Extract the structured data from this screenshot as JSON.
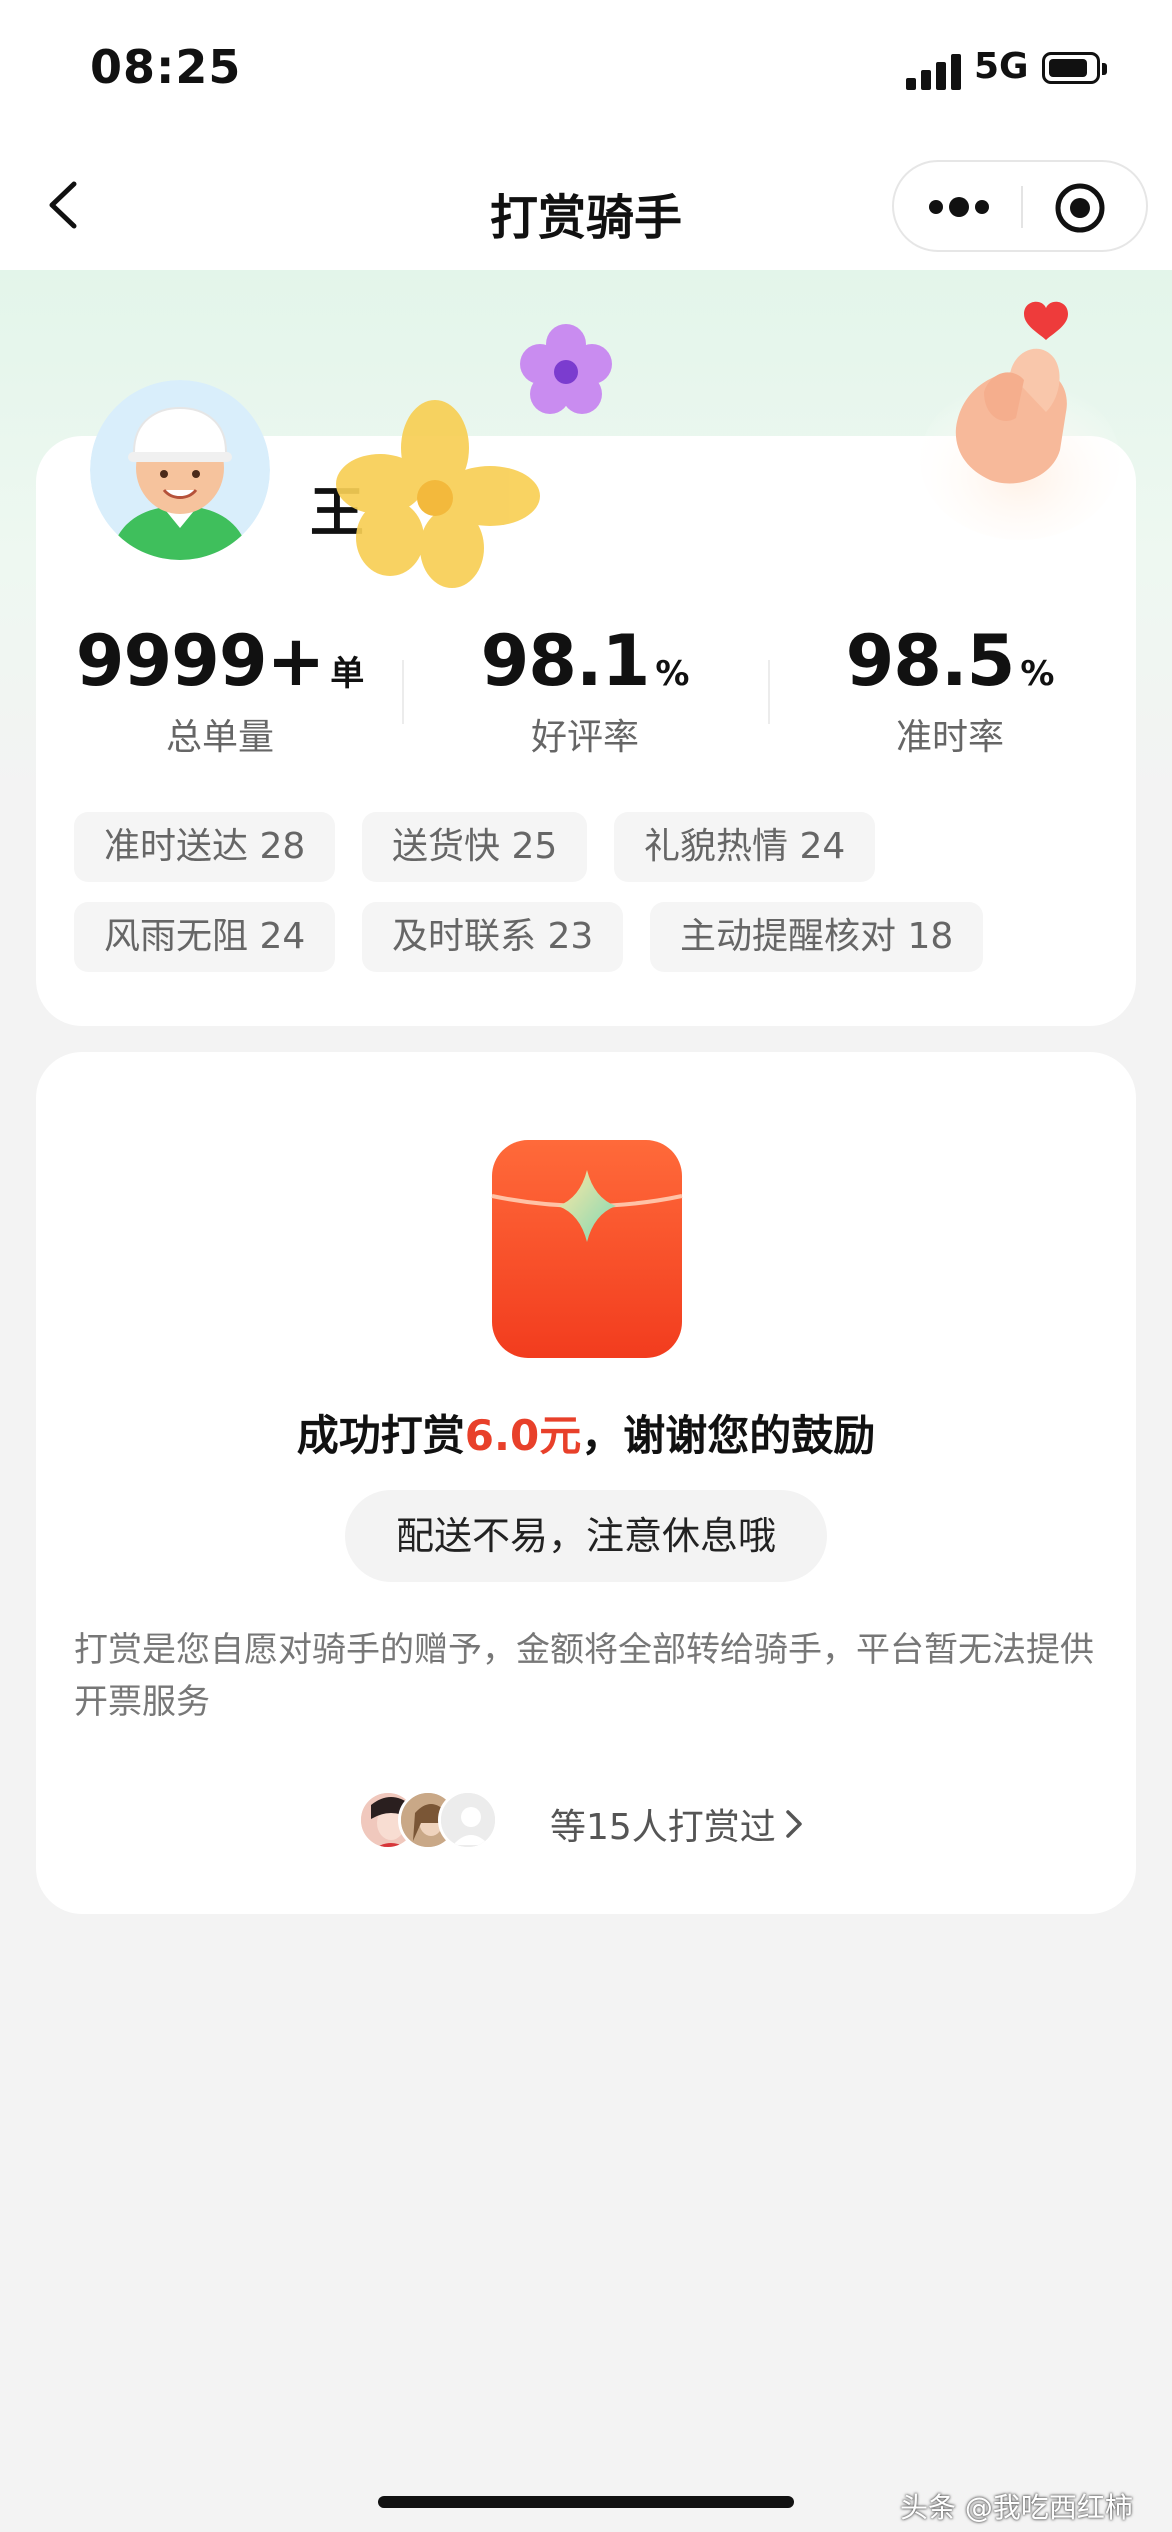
{
  "status_bar": {
    "time": "08:25",
    "network": "5G"
  },
  "nav": {
    "title": "打赏骑手"
  },
  "rider": {
    "name": "王"
  },
  "stats": [
    {
      "value": "9999+",
      "unit": "单",
      "label": "总单量"
    },
    {
      "value": "98.1",
      "unit": "%",
      "label": "好评率"
    },
    {
      "value": "98.5",
      "unit": "%",
      "label": "准时率"
    }
  ],
  "tags": [
    "准时送达 28",
    "送货快 25",
    "礼貌热情 24",
    "风雨无阻 24",
    "及时联系 23",
    "主动提醒核对 18"
  ],
  "reward": {
    "success_prefix": "成功打赏",
    "amount": "6.0元",
    "success_suffix": "，谢谢您的鼓励",
    "message": "配送不易，注意休息哦",
    "notice": "打赏是您自愿对骑手的赠予，金额将全部转给骑手，平台暂无法提供开票服务",
    "givers_text": "等15人打赏过"
  },
  "watermark": "头条 @我吃西红柿",
  "colors": {
    "accent_red": "#e8402a",
    "hero_green": "#e3f5ea"
  }
}
